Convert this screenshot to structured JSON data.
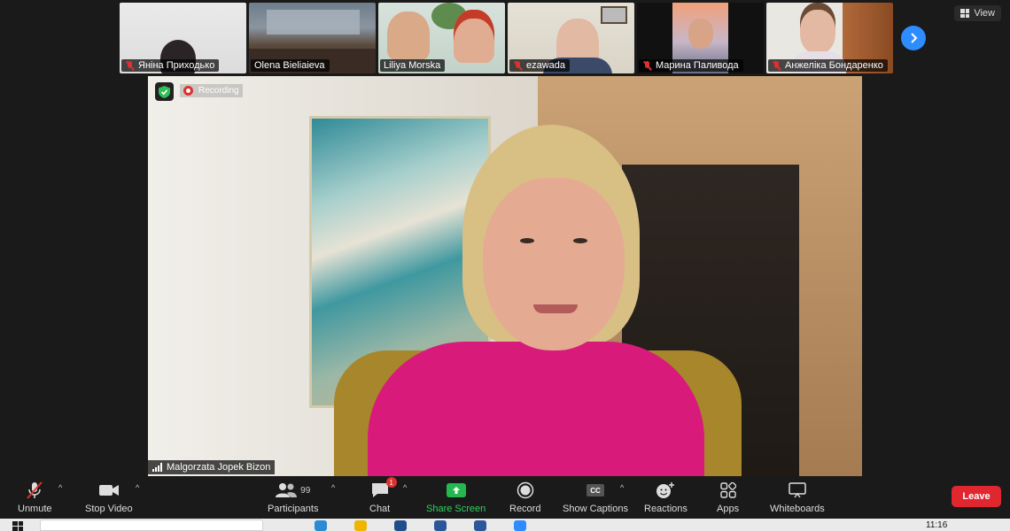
{
  "top": {
    "view_label": "View"
  },
  "gallery": {
    "participants": [
      {
        "name": "Яніна Приходько",
        "muted": true
      },
      {
        "name": "Olena Bieliaieva",
        "muted": false
      },
      {
        "name": "Liliya Morska",
        "muted": false
      },
      {
        "name": "ezawada",
        "muted": true
      },
      {
        "name": "Марина Паливода",
        "muted": true
      },
      {
        "name": "Анжеліка Бондаренко",
        "muted": true
      }
    ]
  },
  "main": {
    "recording_label": "Recording",
    "speaker_name": "Malgorzata Jopek Bizon"
  },
  "toolbar": {
    "unmute": "Unmute",
    "stop_video": "Stop Video",
    "participants": "Participants",
    "participants_count": "99",
    "chat": "Chat",
    "chat_badge": "1",
    "share_screen": "Share Screen",
    "record": "Record",
    "show_captions": "Show Captions",
    "captions_icon_text": "CC",
    "reactions": "Reactions",
    "apps": "Apps",
    "whiteboards": "Whiteboards",
    "leave": "Leave"
  },
  "taskbar": {
    "time": "11:16"
  },
  "colors": {
    "accent_blue": "#2d8cff",
    "share_green": "#25b84f",
    "leave_red": "#e0262e",
    "muted_red": "#e02f2f"
  }
}
